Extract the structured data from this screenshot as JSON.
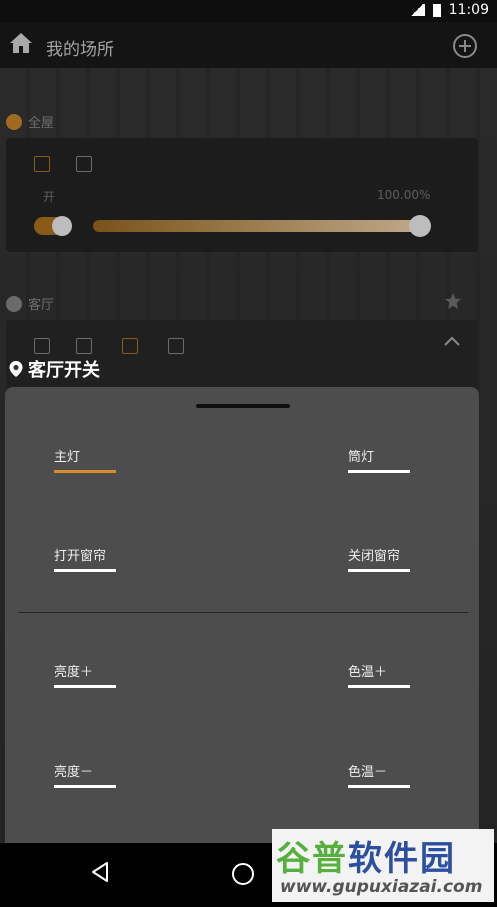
{
  "status_bar": {
    "time": "11:09",
    "network": "LTE"
  },
  "app_bar": {
    "title": "我的场所"
  },
  "background": {
    "section_all": {
      "label": "全屋",
      "state_label": "开",
      "brightness_text": "100.00%"
    },
    "section_living": {
      "label": "客厅"
    }
  },
  "scene": {
    "title": "客厅开关"
  },
  "sheet": {
    "options": [
      {
        "label": "主灯",
        "active": true
      },
      {
        "label": "筒灯",
        "active": false
      },
      {
        "label": "打开窗帘",
        "active": false
      },
      {
        "label": "关闭窗帘",
        "active": false
      },
      {
        "label": "亮度＋",
        "active": false
      },
      {
        "label": "色温＋",
        "active": false
      },
      {
        "label": "亮度－",
        "active": false
      },
      {
        "label": "色温－",
        "active": false
      }
    ]
  },
  "watermark": {
    "brand_part1": "谷普",
    "brand_part2": "软件园",
    "url": "www.gupuxiazai.com"
  },
  "colors": {
    "accent": "#d98c2b",
    "sheet_bg": "#4d4d4d"
  }
}
